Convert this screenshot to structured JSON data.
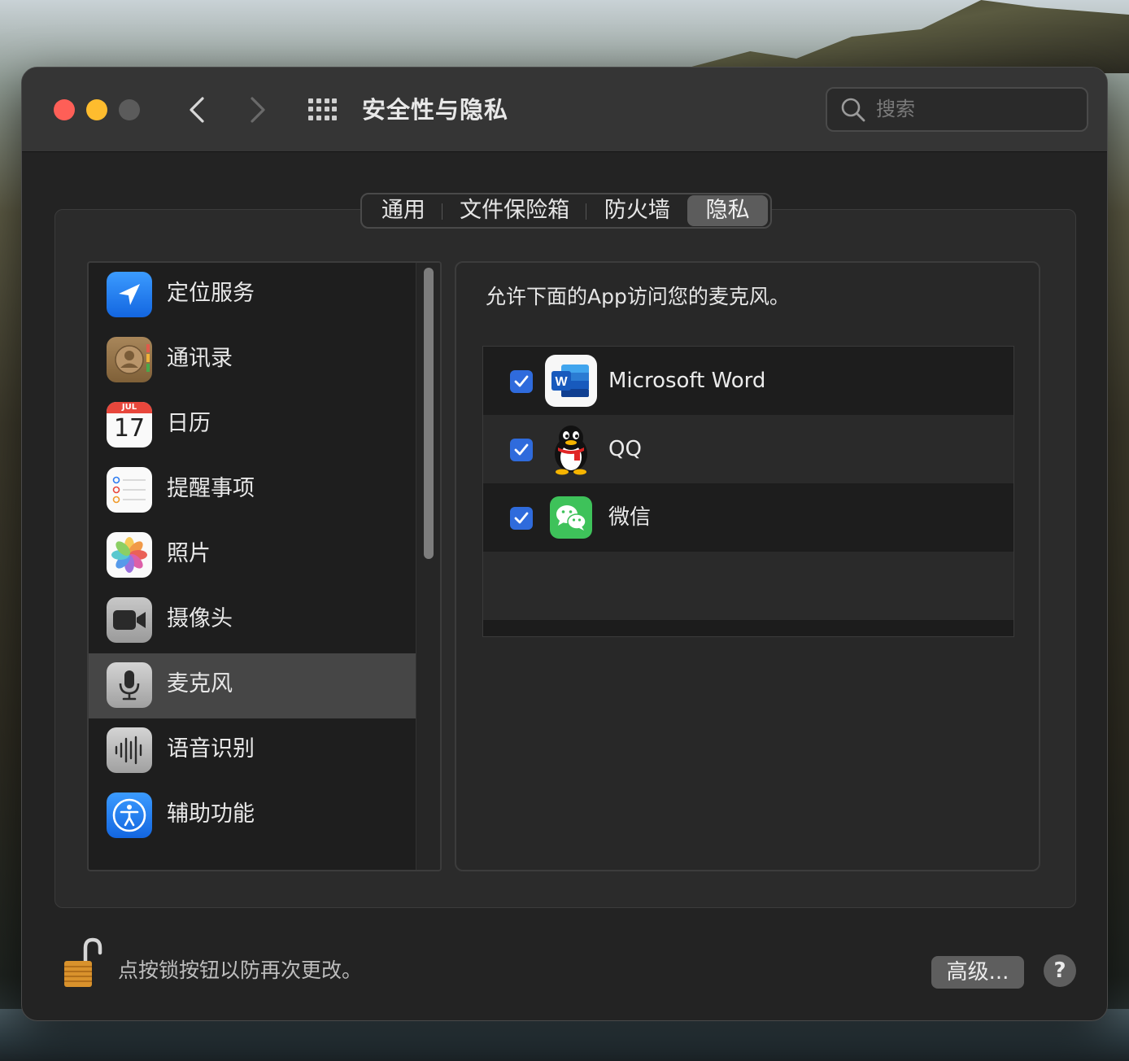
{
  "window": {
    "title": "安全性与隐私",
    "search_placeholder": "搜索"
  },
  "tabs": [
    {
      "label": "通用",
      "active": false
    },
    {
      "label": "文件保险箱",
      "active": false
    },
    {
      "label": "防火墙",
      "active": false
    },
    {
      "label": "隐私",
      "active": true
    }
  ],
  "sidebar": {
    "items": [
      {
        "label": "定位服务",
        "icon": "location-icon"
      },
      {
        "label": "通讯录",
        "icon": "contacts-icon"
      },
      {
        "label": "日历",
        "icon": "calendar-icon",
        "month": "JUL",
        "day": "17"
      },
      {
        "label": "提醒事项",
        "icon": "reminders-icon"
      },
      {
        "label": "照片",
        "icon": "photos-icon"
      },
      {
        "label": "摄像头",
        "icon": "camera-icon"
      },
      {
        "label": "麦克风",
        "icon": "microphone-icon",
        "selected": true
      },
      {
        "label": "语音识别",
        "icon": "speech-recognition-icon"
      },
      {
        "label": "辅助功能",
        "icon": "accessibility-icon"
      }
    ]
  },
  "right": {
    "description": "允许下面的App访问您的麦克风。",
    "apps": [
      {
        "name": "Microsoft Word",
        "checked": true,
        "icon": "microsoft-word-icon"
      },
      {
        "name": "QQ",
        "checked": true,
        "icon": "qq-icon"
      },
      {
        "name": "微信",
        "checked": true,
        "icon": "wechat-icon"
      }
    ]
  },
  "footer": {
    "lock_text": "点按锁按钮以防再次更改。",
    "advanced_label": "高级...",
    "help_label": "?"
  },
  "colors": {
    "accent": "#2f6bdc",
    "close": "#fe5f57",
    "minimize": "#febc2e"
  }
}
